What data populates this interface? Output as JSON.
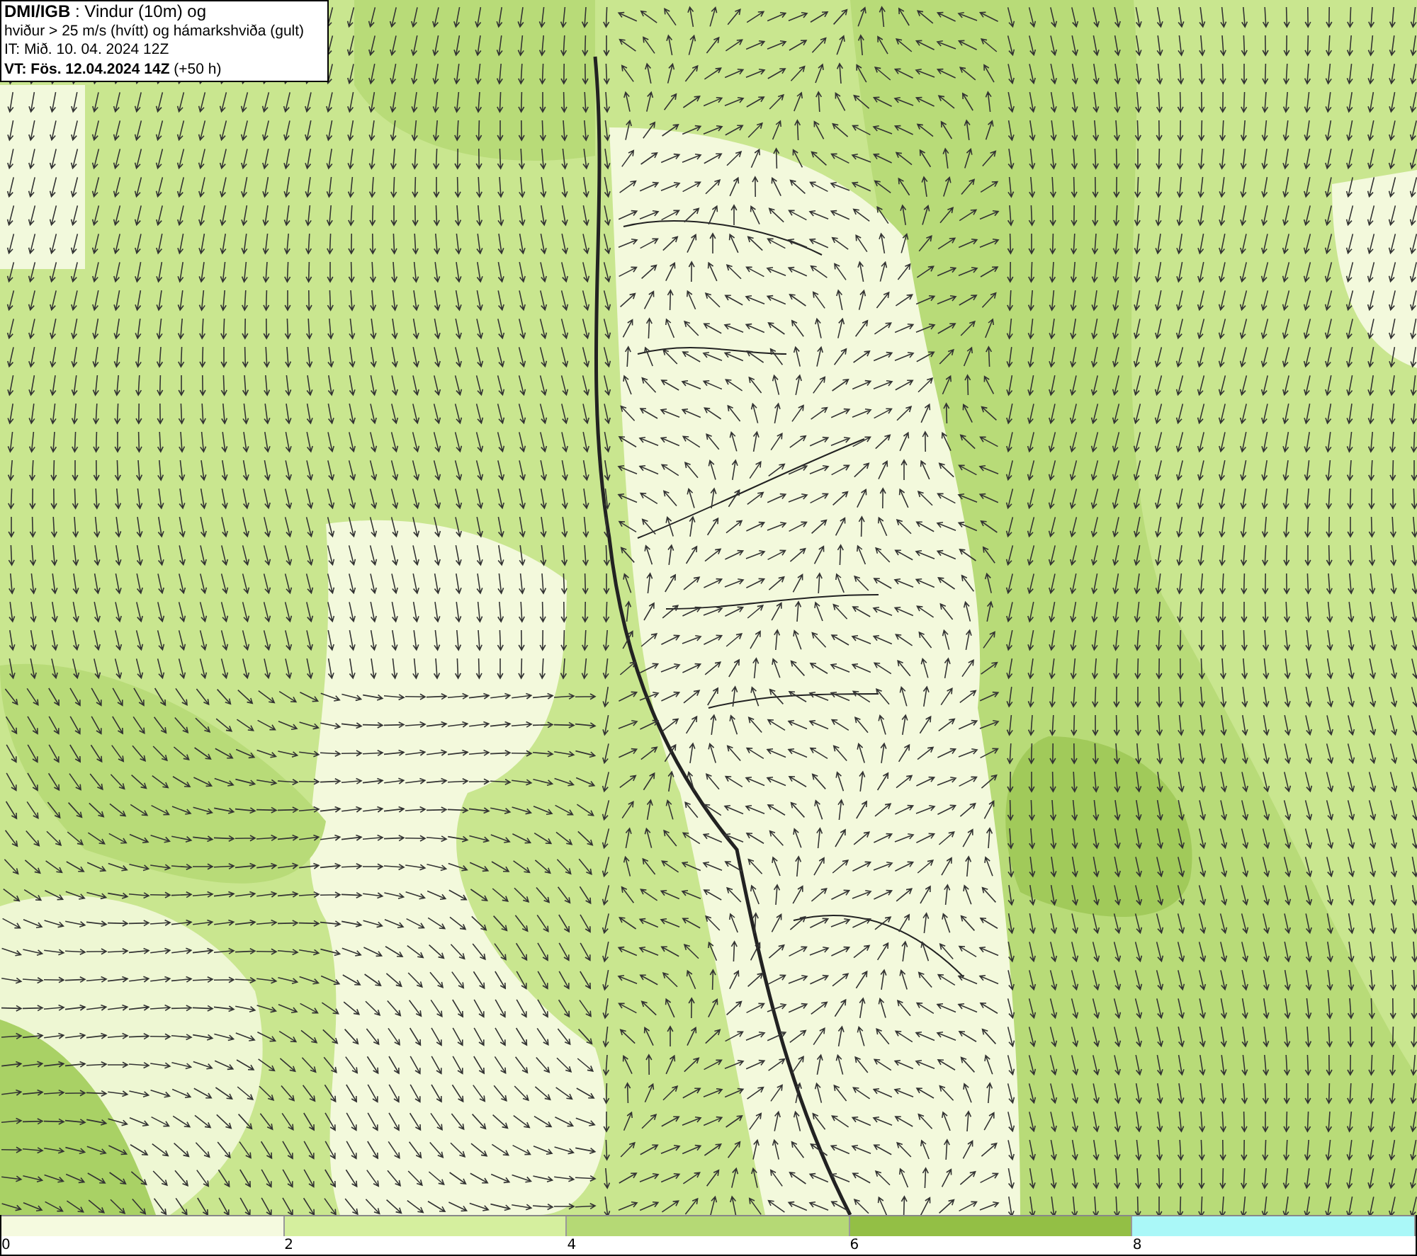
{
  "header": {
    "lines": [
      "**DMI/IGB** : Vindur (10m) og",
      "hviður > 25 m/s (hvítt) og hámarkshviða (gult)",
      "IT: Mið. 10. 04. 2024 12Z",
      "**VT: Fös. 12.04.2024 14Z** (+50 h)"
    ]
  },
  "legend": {
    "bands": [
      {
        "color": "#f5fadf"
      },
      {
        "color": "#d5ef9e"
      },
      {
        "color": "#b5d975"
      },
      {
        "color": "#93bf45"
      },
      {
        "color": "#aaf8f8"
      }
    ],
    "ticks": [
      "0",
      "2",
      "4",
      "6",
      "8"
    ]
  }
}
